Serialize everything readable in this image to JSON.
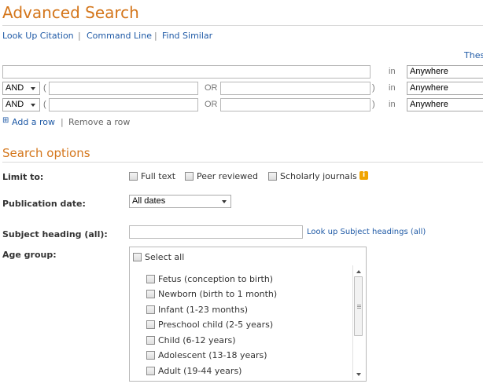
{
  "page": {
    "title": "Advanced Search"
  },
  "toplinks": {
    "citation": "Look Up Citation",
    "command": "Command Line",
    "similar": "Find Similar",
    "sep": "|"
  },
  "thesaurus": {
    "label": "Thes"
  },
  "rows": [
    {
      "operator": "",
      "value": "",
      "in": "in",
      "field": "Anywhere"
    },
    {
      "operator": "AND",
      "open": "(",
      "value1": "",
      "or": "OR",
      "value2": "",
      "close": ")",
      "in": "in",
      "field": "Anywhere"
    },
    {
      "operator": "AND",
      "open": "(",
      "value1": "",
      "or": "OR",
      "value2": "",
      "close": ")",
      "in": "in",
      "field": "Anywhere"
    }
  ],
  "rowlinks": {
    "add_symbol": "⊞",
    "add": "Add a row",
    "sep": "|",
    "remove": "Remove a row"
  },
  "options": {
    "section_title": "Search options",
    "limit_label": "Limit to:",
    "limit_items": [
      "Full text",
      "Peer reviewed",
      "Scholarly journals"
    ],
    "info_glyph": "i",
    "pubdate_label": "Publication date:",
    "pubdate_value": "All dates",
    "subject_label": "Subject heading (all):",
    "subject_value": "",
    "subject_link": "Look up Subject headings (all)",
    "age_label": "Age group:",
    "age_select_all": "Select all",
    "age_items": [
      "Fetus (conception to birth)",
      "Newborn (birth to 1 month)",
      "Infant (1-23 months)",
      "Preschool child (2-5 years)",
      "Child (6-12 years)",
      "Adolescent (13-18 years)",
      "Adult (19-44 years)"
    ]
  },
  "colors": {
    "accent": "#d4761b",
    "link": "#1f5aa6"
  }
}
